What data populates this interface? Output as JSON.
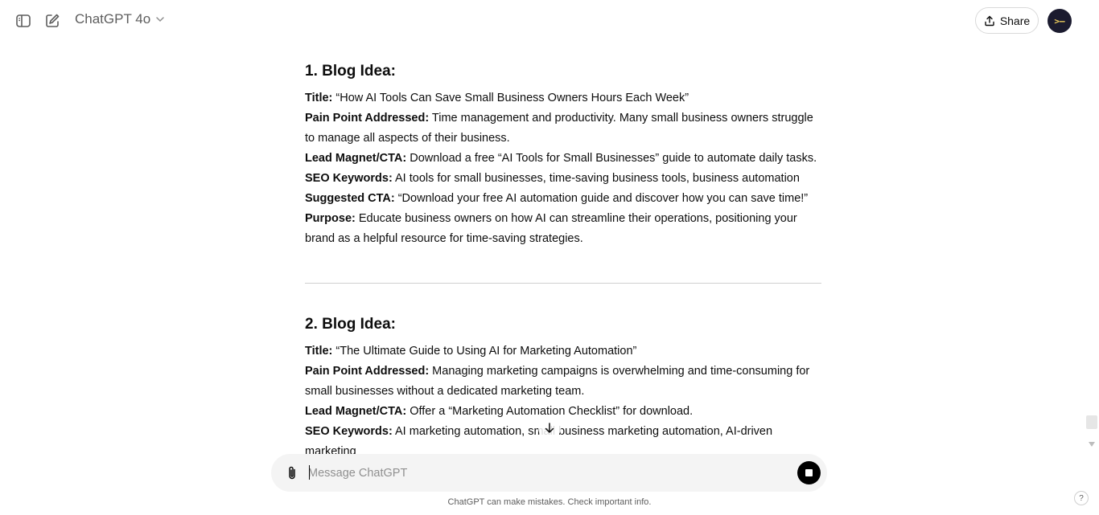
{
  "header": {
    "model_name": "ChatGPT 4o",
    "share_label": "Share",
    "avatar_text": ">–"
  },
  "ideas": [
    {
      "heading": "1. Blog Idea:",
      "fields": [
        {
          "label": "Title:",
          "value": " “How AI Tools Can Save Small Business Owners Hours Each Week”"
        },
        {
          "label": "Pain Point Addressed:",
          "value": " Time management and productivity. Many small business owners struggle to manage all aspects of their business."
        },
        {
          "label": "Lead Magnet/CTA:",
          "value": " Download a free “AI Tools for Small Businesses” guide to automate daily tasks."
        },
        {
          "label": "SEO Keywords:",
          "value": " AI tools for small businesses, time-saving business tools, business automation"
        },
        {
          "label": "Suggested CTA:",
          "value": " “Download your free AI automation guide and discover how you can save time!”"
        },
        {
          "label": "Purpose:",
          "value": " Educate business owners on how AI can streamline their operations, positioning your brand as a helpful resource for time-saving strategies."
        }
      ]
    },
    {
      "heading": "2. Blog Idea:",
      "fields": [
        {
          "label": "Title:",
          "value": " “The Ultimate Guide to Using AI for Marketing Automation”"
        },
        {
          "label": "Pain Point Addressed:",
          "value": " Managing marketing campaigns is overwhelming and time-consuming for small businesses without a dedicated marketing team."
        },
        {
          "label": "Lead Magnet/CTA:",
          "value": " Offer a “Marketing Automation Checklist” for download."
        },
        {
          "label": "SEO Keywords:",
          "value": " AI marketing automation, small business marketing automation, AI-driven marketing"
        }
      ]
    }
  ],
  "composer": {
    "placeholder": "Message ChatGPT"
  },
  "footer": {
    "disclaimer": "ChatGPT can make mistakes. Check important info.",
    "help_label": "?"
  }
}
